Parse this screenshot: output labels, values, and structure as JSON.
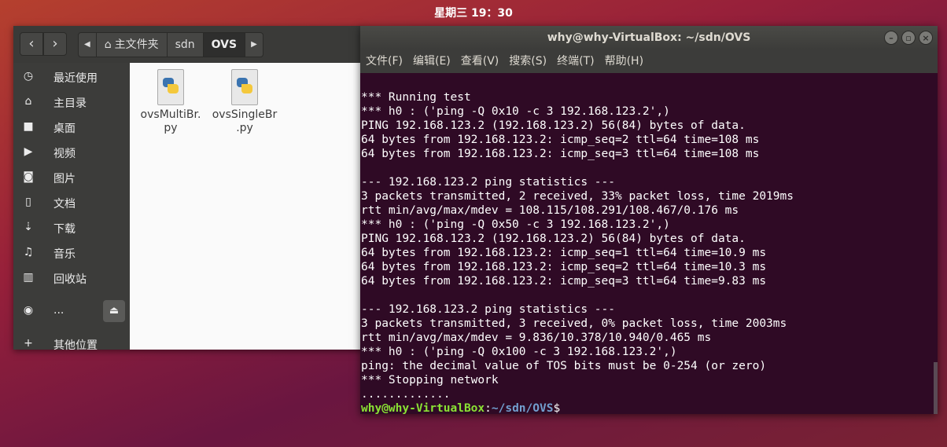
{
  "top_panel": {
    "clock": "星期三 19：30"
  },
  "file_manager": {
    "breadcrumbs": [
      {
        "label": "主文件夹",
        "icon": "home-icon"
      },
      {
        "label": "sdn"
      },
      {
        "label": "OVS"
      }
    ],
    "sidebar": [
      {
        "label": "最近使用",
        "icon": "clock-icon"
      },
      {
        "label": "主目录",
        "icon": "home-icon"
      },
      {
        "label": "桌面",
        "icon": "folder-icon"
      },
      {
        "label": "视频",
        "icon": "video-icon"
      },
      {
        "label": "图片",
        "icon": "camera-icon"
      },
      {
        "label": "文档",
        "icon": "document-icon"
      },
      {
        "label": "下载",
        "icon": "download-icon"
      },
      {
        "label": "音乐",
        "icon": "music-icon"
      },
      {
        "label": "回收站",
        "icon": "trash-icon"
      },
      {
        "label": "...",
        "icon": "disc-icon"
      },
      {
        "label": "其他位置",
        "icon": "plus-icon"
      }
    ],
    "files": [
      {
        "name_line1": "ovsMultiBr.",
        "name_line2": "py"
      },
      {
        "name_line1": "ovsSingleBr",
        "name_line2": ".py"
      }
    ]
  },
  "terminal": {
    "title": "why@why-VirtualBox: ~/sdn/OVS",
    "menu": [
      "文件(F)",
      "编辑(E)",
      "查看(V)",
      "搜索(S)",
      "终端(T)",
      "帮助(H)"
    ],
    "lines": [
      "*** Running test",
      "*** h0 : ('ping -Q 0x10 -c 3 192.168.123.2',)",
      "PING 192.168.123.2 (192.168.123.2) 56(84) bytes of data.",
      "64 bytes from 192.168.123.2: icmp_seq=2 ttl=64 time=108 ms",
      "64 bytes from 192.168.123.2: icmp_seq=3 ttl=64 time=108 ms",
      "",
      "--- 192.168.123.2 ping statistics ---",
      "3 packets transmitted, 2 received, 33% packet loss, time 2019ms",
      "rtt min/avg/max/mdev = 108.115/108.291/108.467/0.176 ms",
      "*** h0 : ('ping -Q 0x50 -c 3 192.168.123.2',)",
      "PING 192.168.123.2 (192.168.123.2) 56(84) bytes of data.",
      "64 bytes from 192.168.123.2: icmp_seq=1 ttl=64 time=10.9 ms",
      "64 bytes from 192.168.123.2: icmp_seq=2 ttl=64 time=10.3 ms",
      "64 bytes from 192.168.123.2: icmp_seq=3 ttl=64 time=9.83 ms",
      "",
      "--- 192.168.123.2 ping statistics ---",
      "3 packets transmitted, 3 received, 0% packet loss, time 2003ms",
      "rtt min/avg/max/mdev = 9.836/10.378/10.940/0.465 ms",
      "*** h0 : ('ping -Q 0x100 -c 3 192.168.123.2',)",
      "ping: the decimal value of TOS bits must be 0-254 (or zero)",
      "*** Stopping network",
      "............."
    ],
    "prompt": {
      "user": "why@why-VirtualBox",
      "sep": ":",
      "path": "~/sdn/OVS",
      "symbol": "$"
    }
  },
  "colors": {
    "prompt_user": "#8ae234",
    "prompt_path": "#729fcf",
    "terminal_bg": "#2f0a25"
  }
}
